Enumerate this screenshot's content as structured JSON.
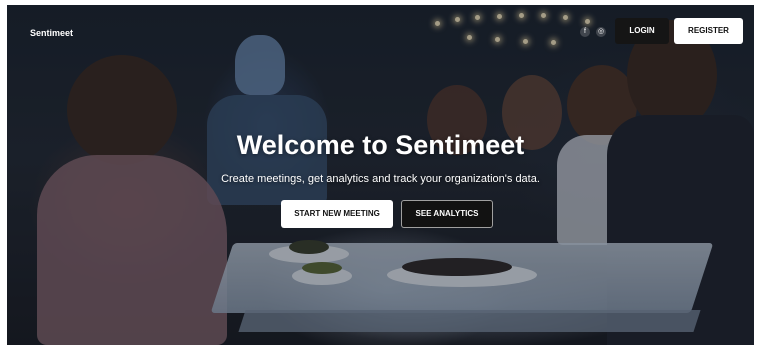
{
  "header": {
    "brand": "Sentimeet",
    "social": [
      {
        "icon": "facebook-icon",
        "glyph": "f"
      },
      {
        "icon": "instagram-icon",
        "glyph": "◎"
      }
    ],
    "login_label": "LOGIN",
    "register_label": "REGISTER"
  },
  "hero": {
    "title": "Welcome to Sentimeet",
    "subtitle": "Create meetings, get analytics and track your organization's data.",
    "primary_cta": "START NEW MEETING",
    "secondary_cta": "SEE ANALYTICS",
    "background_image": "dinner-party-with-robot-photo"
  },
  "colors": {
    "dark_button": "#151515",
    "light_button": "#ffffff",
    "text_on_hero": "#ffffff"
  }
}
